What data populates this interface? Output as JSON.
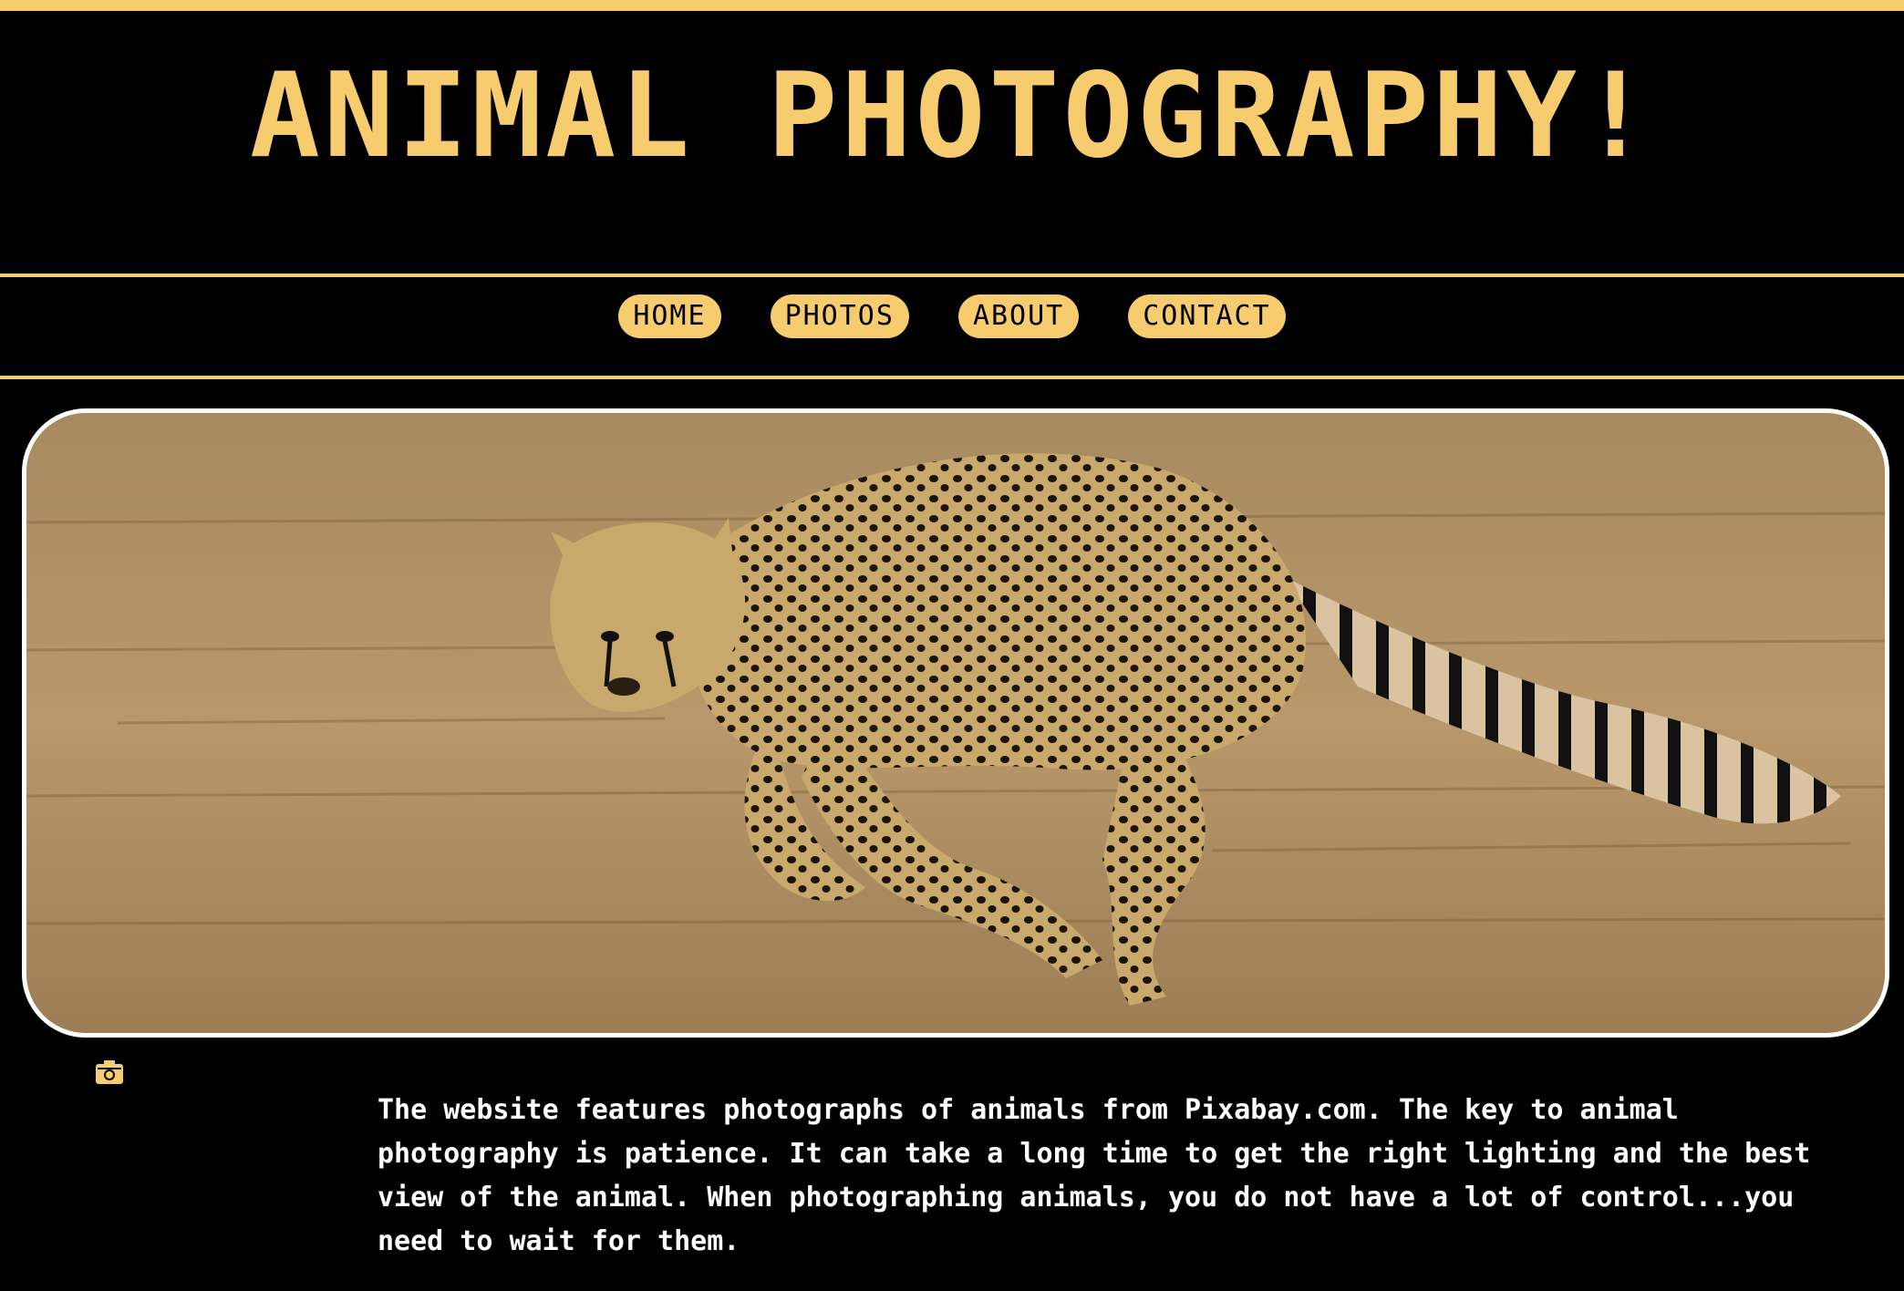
{
  "site": {
    "title": "ANIMAL PHOTOGRAPHY!"
  },
  "nav": {
    "items": [
      {
        "label": "HOME"
      },
      {
        "label": "PHOTOS"
      },
      {
        "label": "ABOUT"
      },
      {
        "label": "CONTACT"
      }
    ]
  },
  "hero": {
    "subject": "running cheetah on dirt ground"
  },
  "credit": {
    "icon": "camera-icon"
  },
  "intro": {
    "text": "The website features photographs of animals from Pixabay.com. The key to animal photography is patience. It can take a long time to get the right lighting and the best view of the animal. When photographing animals, you do not have a lot of control...you need to wait for them."
  },
  "colors": {
    "accent": "#F7CC6E",
    "background": "#000000",
    "text": "#FFFFFF",
    "hero_border": "#FFFFFF"
  }
}
